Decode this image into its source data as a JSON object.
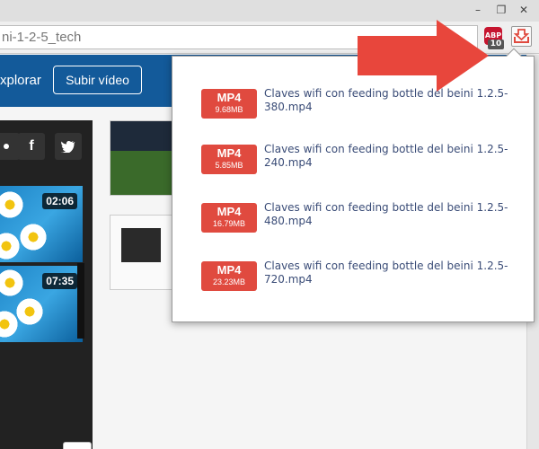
{
  "browser": {
    "url_text": "ni-1-2-5_tech",
    "window_controls": {
      "minimize": "–",
      "maximize": "❐",
      "close": "✕"
    },
    "extensions": {
      "adblock": {
        "label": "ABP",
        "count": "10",
        "color": "#c6152f"
      },
      "downloader": {
        "icon": "download-arrow-icon",
        "color": "#e04a3f"
      }
    }
  },
  "site": {
    "nav_explore": "xplorar",
    "upload_button": "Subir vídeo",
    "header_color": "#135a9a",
    "share": {
      "facebook": "f",
      "twitter": "t"
    },
    "thumbnails": [
      {
        "duration": "02:06"
      },
      {
        "duration": "07:35"
      }
    ]
  },
  "popup": {
    "accent_color": "#e04a3f",
    "items": [
      {
        "format": "MP4",
        "size": "9.68MB",
        "name_line1": "Claves wifi con feeding bottle del beini 1.2.5-",
        "name_line2": "380.mp4"
      },
      {
        "format": "MP4",
        "size": "5.85MB",
        "name_line1": "Claves wifi con feeding bottle del beini 1.2.5-",
        "name_line2": "240.mp4"
      },
      {
        "format": "MP4",
        "size": "16.79MB",
        "name_line1": "Claves wifi con feeding bottle del beini 1.2.5-",
        "name_line2": "480.mp4"
      },
      {
        "format": "MP4",
        "size": "23.23MB",
        "name_line1": "Claves wifi con feeding bottle del beini 1.2.5-",
        "name_line2": "720.mp4"
      }
    ]
  },
  "annotation": {
    "arrow_color": "#e8463c"
  }
}
